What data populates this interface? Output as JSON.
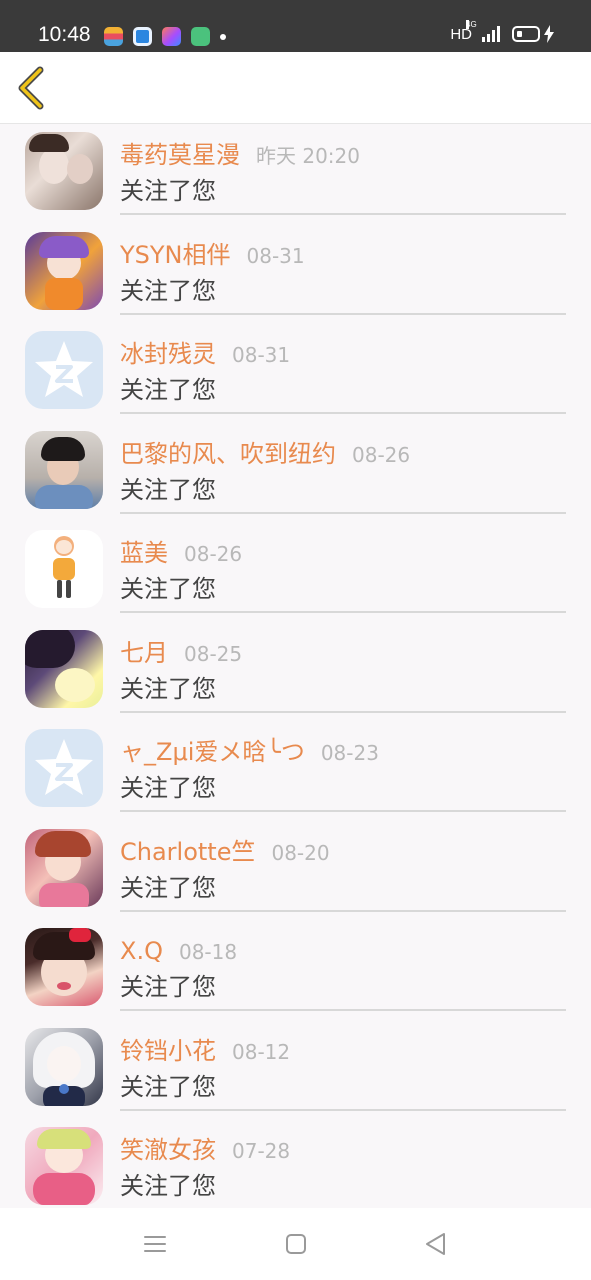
{
  "status_bar": {
    "time": "10:48",
    "network_label": "HD",
    "network_type": "4G",
    "app_icons": [
      "app-icon-1",
      "app-icon-2",
      "app-icon-3",
      "app-icon-4"
    ]
  },
  "header": {
    "back_icon": "chevron-left-icon",
    "accent_color": "#f0c419"
  },
  "notifications": [
    {
      "name": "毒药莫星漫",
      "time": "昨天 20:20",
      "action": "关注了您",
      "avatar": "photo"
    },
    {
      "name": "YSYN相伴",
      "time": "08-31",
      "action": "关注了您",
      "avatar": "anime"
    },
    {
      "name": "冰封残灵",
      "time": "08-31",
      "action": "关注了您",
      "avatar": "default-qq"
    },
    {
      "name": "巴黎的风、吹到纽约",
      "time": "08-26",
      "action": "关注了您",
      "avatar": "photo"
    },
    {
      "name": "蓝美",
      "time": "08-26",
      "action": "关注了您",
      "avatar": "chibi"
    },
    {
      "name": "七月",
      "time": "08-25",
      "action": "关注了您",
      "avatar": "anime"
    },
    {
      "name": "ャ_Zμi爱メ晗╰つ",
      "time": "08-23",
      "action": "关注了您",
      "avatar": "default-qq"
    },
    {
      "name": "Charlotte竺",
      "time": "08-20",
      "action": "关注了您",
      "avatar": "anime"
    },
    {
      "name": "X.Q",
      "time": "08-18",
      "action": "关注了您",
      "avatar": "photo"
    },
    {
      "name": "铃铛小花",
      "time": "08-12",
      "action": "关注了您",
      "avatar": "anime"
    },
    {
      "name": "笑澈女孩",
      "time": "07-28",
      "action": "关注了您",
      "avatar": "anime"
    }
  ],
  "colors": {
    "name": "#e88a4e",
    "time": "#b8b8b8",
    "action": "#444444",
    "background": "#f9f7f9"
  },
  "nav_bar": {
    "icons": [
      "menu-icon",
      "home-square-icon",
      "back-triangle-icon"
    ]
  }
}
